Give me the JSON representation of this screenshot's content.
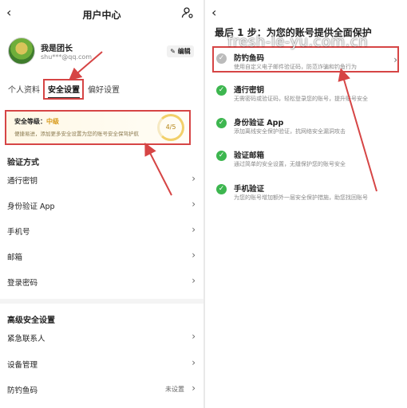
{
  "left": {
    "header": {
      "back": "‹",
      "title": "用户中心"
    },
    "profile": {
      "name": "我是团长",
      "email": "shu***@qq.com",
      "edit_label": "✎ 编辑"
    },
    "tabs": [
      {
        "label": "个人资料",
        "active": false
      },
      {
        "label": "安全设置",
        "active": true
      },
      {
        "label": "偏好设置",
        "active": false
      }
    ],
    "security_card": {
      "level_prefix": "安全等级：",
      "level_value": "中级",
      "description": "便捷易进，添加更多安全设置为您的账号安全保驾护航",
      "score": "4/5"
    },
    "verification": {
      "heading": "验证方式",
      "items": [
        {
          "label": "通行密钥"
        },
        {
          "label": "身份验证 App"
        },
        {
          "label": "手机号"
        },
        {
          "label": "邮箱"
        },
        {
          "label": "登录密码"
        }
      ]
    },
    "advanced": {
      "heading": "高级安全设置",
      "items": [
        {
          "label": "紧急联系人",
          "value": ""
        },
        {
          "label": "设备管理",
          "value": ""
        },
        {
          "label": "防钓鱼码",
          "value": "未设置"
        }
      ]
    },
    "chevron": "›"
  },
  "right": {
    "back": "‹",
    "heading": "最后 1 步：为您的账号提供全面保护",
    "watermark": "fresh-le-yu.com.cn",
    "items": [
      {
        "title": "防钓鱼码",
        "desc": "使用自定义电子邮件验证码，防范诈骗和钓鱼行为",
        "status": "pending"
      },
      {
        "title": "通行密钥",
        "desc": "无需密码或验证码，轻松登录您的账号，提升账号安全",
        "status": "done"
      },
      {
        "title": "身份验证 App",
        "desc": "添加离线安全保护验证，抗网络安全漏洞攻击",
        "status": "done"
      },
      {
        "title": "验证邮箱",
        "desc": "通过简单的安全设置，无缝保护您的账号安全",
        "status": "done"
      },
      {
        "title": "手机验证",
        "desc": "为您的账号增加额外一层安全保护措施，助您找回账号",
        "status": "done"
      }
    ],
    "chevron": "›",
    "check_glyph": "✓"
  },
  "colors": {
    "accent_red": "#d64545",
    "check_green": "#3db64f",
    "level_orange": "#d89a1a"
  }
}
